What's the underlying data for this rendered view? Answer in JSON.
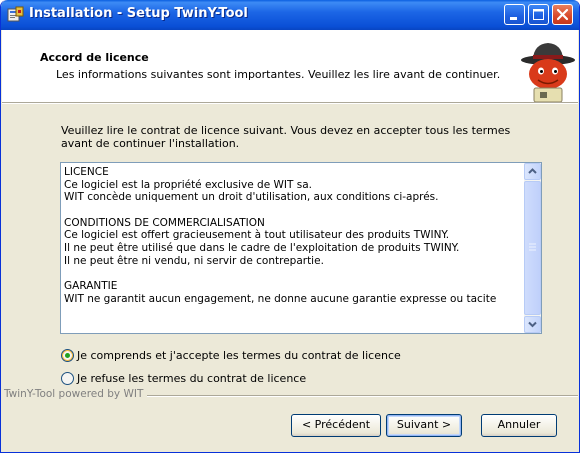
{
  "window": {
    "title": "Installation - Setup TwinY-Tool",
    "title_color": "#ffffff",
    "titlebar_color": "#0a4fd6"
  },
  "header": {
    "title": "Accord de licence",
    "subtitle": "Les informations suivantes sont importantes. Veuillez les lire avant de continuer."
  },
  "intro": "Veuillez lire le contrat de licence suivant. Vous devez en accepter tous les termes avant de continuer l'installation.",
  "license_lines": [
    "LICENCE",
    "Ce logiciel est la propriété exclusive de WIT sa.",
    "WIT concède uniquement un droit d'utilisation, aux conditions ci-aprés.",
    "",
    "CONDITIONS DE COMMERCIALISATION",
    "Ce logiciel est offert gracieusement à tout utilisateur des produits TWINY.",
    "Il ne peut être utilisé que dans le cadre de l'exploitation de produits TWINY.",
    "Il ne peut être ni vendu, ni servir de contrepartie.",
    "",
    "GARANTIE",
    "WIT ne garantit aucun engagement, ne donne aucune garantie expresse ou tacite"
  ],
  "options": {
    "accept": {
      "label": "Je comprends et j'accepte les termes du contrat de licence",
      "selected": true
    },
    "refuse": {
      "label": "Je refuse les termes du contrat de licence",
      "selected": false
    }
  },
  "footer": {
    "powered_by": "TwinY-Tool powered by WIT",
    "back_label": "< Précédent",
    "next_label": "Suivant >",
    "cancel_label": "Annuler"
  },
  "icons": {
    "title": "installer-icon",
    "header": "mascot-hat-icon",
    "minimize": "minimize-icon",
    "maximize": "maximize-icon",
    "close": "close-icon",
    "scroll_up": "chevron-up-icon",
    "scroll_down": "chevron-down-icon"
  }
}
